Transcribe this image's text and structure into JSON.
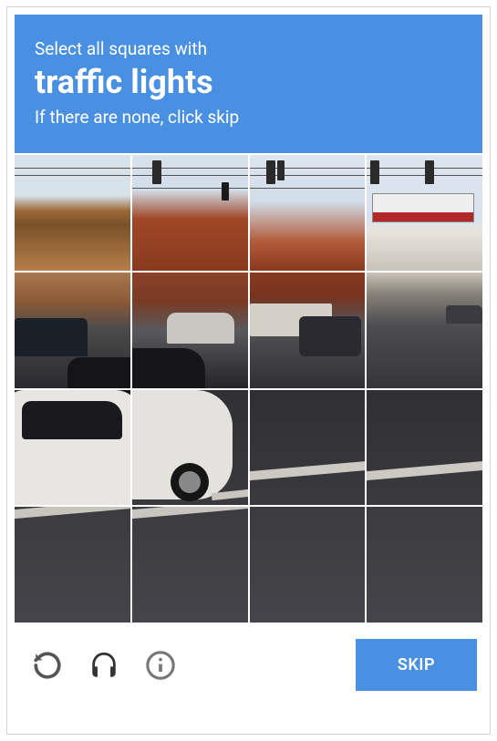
{
  "header": {
    "prompt_prefix": "Select all squares with",
    "subject": "traffic lights",
    "instruction": "If there are none, click skip"
  },
  "grid": {
    "rows": 4,
    "cols": 4
  },
  "footer": {
    "skip_label": "SKIP"
  },
  "icons": {
    "reload": "reload-icon",
    "audio": "headphones-icon",
    "info": "info-icon"
  }
}
